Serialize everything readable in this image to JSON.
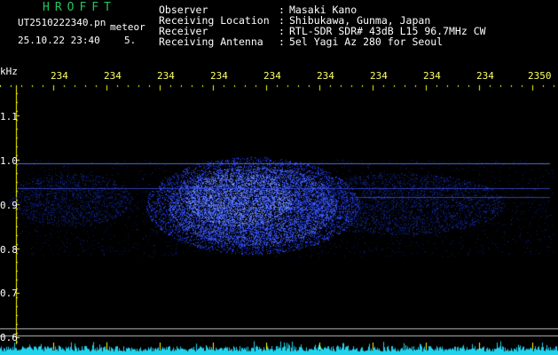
{
  "header": {
    "logo": "HROFFT",
    "filename": "UT2510222340.pn",
    "meteor_label": "meteor",
    "datetime": "25.10.22 23:40",
    "count": "5.",
    "rows": [
      {
        "label": "Observer",
        "sep": ":",
        "value": "Masaki Kano"
      },
      {
        "label": "Receiving Location",
        "sep": ":",
        "value": "Shibukawa, Gunma, Japan"
      },
      {
        "label": "Receiver",
        "sep": ":",
        "value": "RTL-SDR SDR# 43dB L15 96.7MHz CW"
      },
      {
        "label": "Receiving Antenna",
        "sep": ":",
        "value": "5el Yagi Az 280 for Seoul"
      }
    ]
  },
  "time_axis": {
    "labels": [
      "234",
      "234",
      "234",
      "234",
      "234",
      "234",
      "234",
      "234",
      "234",
      "2350"
    ]
  },
  "freq_axis": {
    "unit": "kHz",
    "labels": [
      "1.1",
      "1.0",
      "0.9",
      "0.8",
      "0.7",
      "0.6"
    ]
  },
  "colors": {
    "logo": "#22c55e",
    "axis_labels": "#ffff66",
    "grid": "#ffff00",
    "signal": "#2040ff",
    "noise_floor": "#22d3ee"
  }
}
